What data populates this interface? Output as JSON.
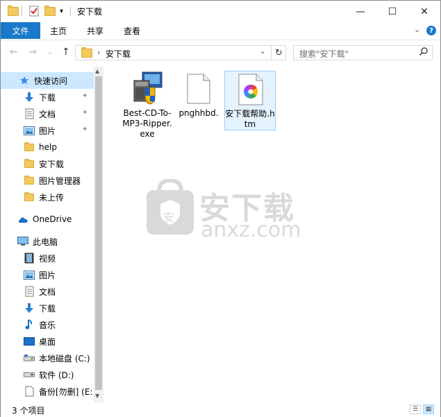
{
  "window": {
    "title": "安下载",
    "minimize_glyph": "—",
    "maximize_glyph": "☐",
    "close_glyph": "✕"
  },
  "ribbon": {
    "tabs": [
      {
        "label": "文件",
        "active": true
      },
      {
        "label": "主页"
      },
      {
        "label": "共享"
      },
      {
        "label": "查看"
      }
    ],
    "expand_glyph": "⌄",
    "help_glyph": "?"
  },
  "address": {
    "back_glyph": "←",
    "forward_glyph": "→",
    "recent_glyph": "⌄",
    "up_glyph": "↑",
    "chevron": "›",
    "path": "安下载",
    "dropdown_glyph": "⌄",
    "refresh_glyph": "↻"
  },
  "search": {
    "placeholder": "搜索\"安下载\"",
    "icon": "search-icon"
  },
  "sidebar": {
    "items": [
      {
        "label": "快速访问",
        "icon": "star-icon",
        "selected": true
      },
      {
        "label": "下载",
        "icon": "download-icon",
        "pinned": true
      },
      {
        "label": "文档",
        "icon": "document-icon",
        "pinned": true
      },
      {
        "label": "图片",
        "icon": "picture-icon",
        "pinned": true
      },
      {
        "label": "help",
        "icon": "folder-icon"
      },
      {
        "label": "安下载",
        "icon": "folder-icon"
      },
      {
        "label": "图片管理器",
        "icon": "folder-icon"
      },
      {
        "label": "未上传",
        "icon": "folder-icon"
      },
      {
        "label": "OneDrive",
        "icon": "cloud-icon"
      },
      {
        "label": "此电脑",
        "icon": "computer-icon"
      },
      {
        "label": "视频",
        "icon": "video-icon"
      },
      {
        "label": "图片",
        "icon": "picture-icon"
      },
      {
        "label": "文档",
        "icon": "document-icon"
      },
      {
        "label": "下载",
        "icon": "download-icon"
      },
      {
        "label": "音乐",
        "icon": "music-icon"
      },
      {
        "label": "桌面",
        "icon": "desktop-icon"
      },
      {
        "label": "本地磁盘 (C:)",
        "icon": "drive-icon"
      },
      {
        "label": "软件 (D:)",
        "icon": "drive-icon"
      },
      {
        "label": "备份[勿删] (E:)",
        "icon": "drive-icon"
      }
    ],
    "pin_glyph": "📌"
  },
  "files": [
    {
      "name": "Best-CD-To-MP3-Ripper.exe",
      "icon": "installer-icon"
    },
    {
      "name": "pnghhbd.",
      "icon": "blank-file-icon"
    },
    {
      "name": "安下载帮助.htm",
      "icon": "html-file-icon",
      "selected": true
    }
  ],
  "watermark": {
    "text_cn": "安下载",
    "text_en": "anxz.com",
    "badge": "安"
  },
  "status": {
    "item_count": "3 个项目"
  },
  "colors": {
    "accent": "#1979ca",
    "selected_bg": "#cce8ff",
    "folder": "#f4c95d"
  }
}
